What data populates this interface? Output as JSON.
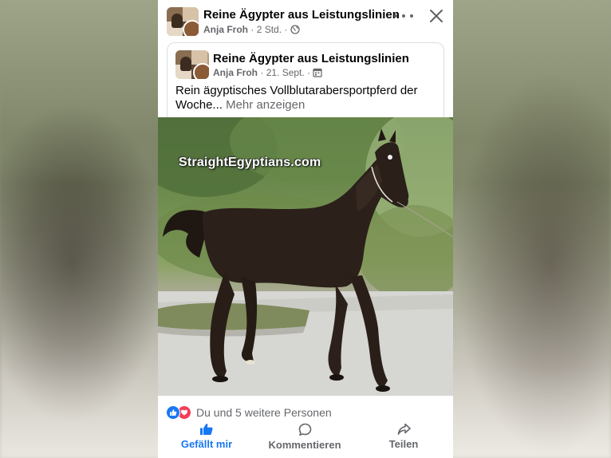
{
  "post": {
    "page_name": "Reine Ägypter aus Leistungslinien",
    "author": "Anja Froh",
    "time": "2 Std.",
    "separator": "·",
    "privacy_icon": "globe-icon",
    "more_icon": "more-horizontal-icon",
    "close_icon": "close-icon"
  },
  "shared": {
    "page_name": "Reine Ägypter aus Leistungslinien",
    "author": "Anja Froh",
    "date": "21. Sept.",
    "separator": "·",
    "privacy_icon": "calendar-icon",
    "text": "Rein ägyptisches Vollblutarabersportpferd der Woche...",
    "see_more": "Mehr anzeigen"
  },
  "photo": {
    "watermark": "StraightEgyptians.com"
  },
  "reactions": {
    "icons": [
      "like-icon",
      "love-icon"
    ],
    "summary": "Du und 5 weitere Personen"
  },
  "actions": {
    "like": "Gefällt mir",
    "comment": "Kommentieren",
    "share": "Teilen"
  },
  "colors": {
    "accent": "#1877f2",
    "love": "#f33e58",
    "secondary_text": "#65676b",
    "primary_text": "#050505"
  }
}
